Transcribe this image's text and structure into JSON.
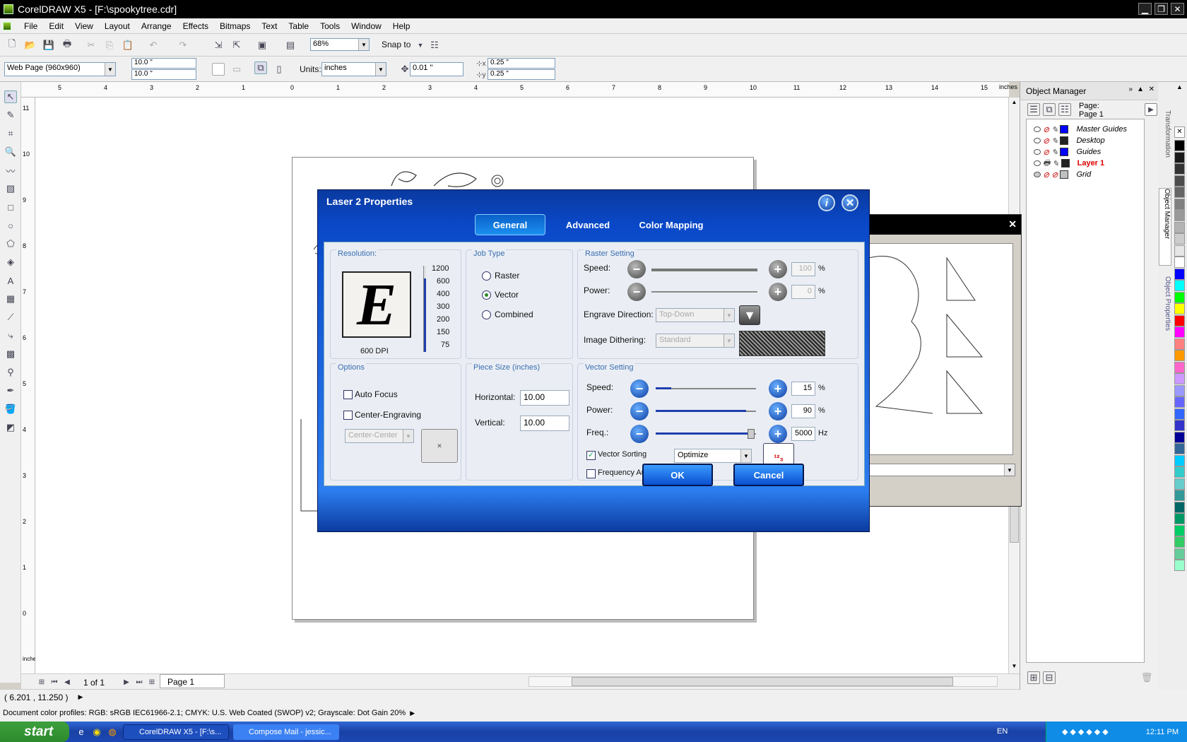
{
  "window": {
    "title": "CorelDRAW X5 - [F:\\spookytree.cdr]",
    "min": "▁",
    "max": "❐",
    "close": "✕"
  },
  "menu": [
    "File",
    "Edit",
    "View",
    "Layout",
    "Arrange",
    "Effects",
    "Bitmaps",
    "Text",
    "Table",
    "Tools",
    "Window",
    "Help"
  ],
  "toolbar": {
    "zoom": "68%",
    "snap_to": "Snap to"
  },
  "propbar": {
    "preset": "Web Page (960x960)",
    "width": "10.0 \"",
    "height": "10.0 \"",
    "units_label": "Units:",
    "units": "inches",
    "nudge": "0.01 \"",
    "dup_x": "0.25 \"",
    "dup_y": "0.25 \""
  },
  "ruler": {
    "h_ticks": [
      "5",
      "4",
      "3",
      "2",
      "1",
      "0",
      "1",
      "2",
      "3",
      "4",
      "5",
      "6",
      "7",
      "8",
      "9",
      "10",
      "11",
      "12",
      "13",
      "14",
      "15"
    ],
    "h_unit": "inches",
    "v_ticks": [
      "11",
      "10",
      "9",
      "8",
      "7",
      "6",
      "5",
      "4",
      "3",
      "2",
      "1",
      "0"
    ],
    "v_unit": "inches"
  },
  "pagenav": {
    "count": "1 of 1",
    "tab": "Page 1"
  },
  "status": {
    "coords": "( 6.201 , 11.250 )",
    "profiles": "Document color profiles: RGB: sRGB IEC61966-2.1; CMYK: U.S. Web Coated (SWOP) v2; Grayscale: Dot Gain 20%"
  },
  "objmgr": {
    "title": "Object Manager",
    "page_label": "Page:",
    "page_name": "Page 1",
    "layers": [
      {
        "name": "Master Guides",
        "color": "#0000ff"
      },
      {
        "name": "Desktop",
        "color": "#222222"
      },
      {
        "name": "Guides",
        "color": "#0000ff"
      },
      {
        "name": "Layer 1",
        "color": "#222222",
        "active": true
      },
      {
        "name": "Grid",
        "color": "#c0c0c0"
      }
    ]
  },
  "dockertabs": {
    "transformation": "Transformation",
    "object_manager": "Object Manager",
    "object_properties": "Object Properties"
  },
  "dialog": {
    "title": "Laser 2 Properties",
    "tabs": [
      "General",
      "Advanced",
      "Color Mapping"
    ],
    "resolution": {
      "label": "Resolution:",
      "letter": "E",
      "dpi": "600 DPI",
      "scale": [
        "1200",
        "600",
        "400",
        "300",
        "200",
        "150",
        "75"
      ]
    },
    "job_type": {
      "label": "Job Type",
      "options": [
        "Raster",
        "Vector",
        "Combined"
      ],
      "selected": "Vector"
    },
    "raster": {
      "label": "Raster Setting",
      "speed_label": "Speed:",
      "speed": "100",
      "power_label": "Power:",
      "power": "0",
      "pct": "%",
      "engrave_label": "Engrave Direction:",
      "engrave": "Top-Down",
      "dither_label": "Image Dithering:",
      "dither": "Standard"
    },
    "options": {
      "label": "Options",
      "auto_focus": "Auto Focus",
      "center_engraving": "Center-Engraving",
      "center_pos": "Center-Center"
    },
    "piece": {
      "label": "Piece Size (inches)",
      "h_label": "Horizontal:",
      "h": "10.00",
      "v_label": "Vertical:",
      "v": "10.00"
    },
    "vector": {
      "label": "Vector Setting",
      "speed_label": "Speed:",
      "speed": "15",
      "power_label": "Power:",
      "power": "90",
      "freq_label": "Freq.:",
      "freq": "5000",
      "pct": "%",
      "hz": "Hz",
      "sorting": "Vector Sorting",
      "sorting_mode": "Optimize",
      "freq_auto": "Frequency Automatic"
    },
    "ok": "OK",
    "cancel": "Cancel"
  },
  "taskbar": {
    "start": "start",
    "tasks": [
      "CorelDRAW X5 - [F:\\s...",
      "Compose Mail - jessic..."
    ],
    "lang": "EN",
    "time": "12:11 PM"
  },
  "palette_colors": [
    "#000000",
    "#1a1a1a",
    "#333333",
    "#4d4d4d",
    "#666666",
    "#808080",
    "#999999",
    "#b3b3b3",
    "#cccccc",
    "#e6e6e6",
    "#ffffff",
    "#0000ff",
    "#00ffff",
    "#00ff00",
    "#ffff00",
    "#ff0000",
    "#ff00ff",
    "#ff8080",
    "#ff9900",
    "#ff66cc",
    "#cc99ff",
    "#9999ff",
    "#6666ff",
    "#3366ff",
    "#3333cc",
    "#000099",
    "#336699",
    "#00ccff",
    "#33cccc",
    "#66cccc",
    "#339999",
    "#006666",
    "#009966",
    "#00cc66",
    "#33cc66",
    "#66cc99",
    "#99ffcc"
  ]
}
